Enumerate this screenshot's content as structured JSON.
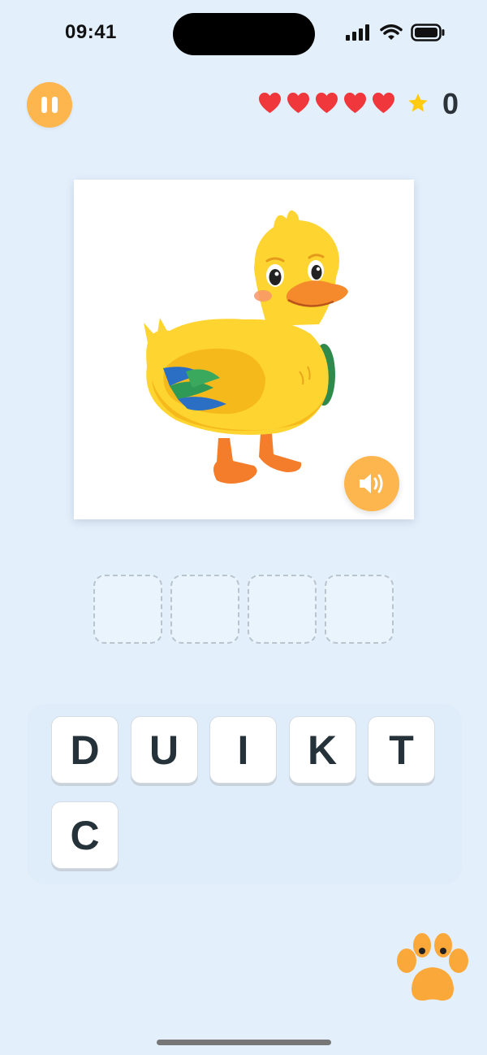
{
  "status": {
    "time": "09:41",
    "icons": [
      "signal-icon",
      "wifi-icon",
      "battery-icon"
    ]
  },
  "controls": {
    "pause_icon": "pause-icon",
    "lives": 5,
    "heart_color": "#f0373b",
    "star_icon": "star-icon",
    "score": "0"
  },
  "card": {
    "image_subject": "duck",
    "sound_icon": "speaker-icon"
  },
  "answer": {
    "slot_count": 4,
    "slots": [
      "",
      "",
      "",
      ""
    ]
  },
  "letters": [
    "D",
    "U",
    "I",
    "K",
    "T",
    "C"
  ],
  "footer": {
    "paw_icon": "paw-icon"
  },
  "colors": {
    "accent": "#fdb54e",
    "background": "#e3effb",
    "heart": "#f0373b",
    "star": "#ffcb0f",
    "tile_text": "#25323a"
  }
}
